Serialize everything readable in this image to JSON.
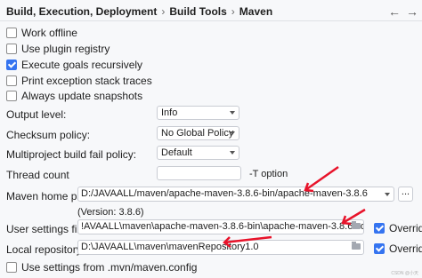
{
  "breadcrumb": {
    "items": [
      "Build, Execution, Deployment",
      "Build Tools",
      "Maven"
    ]
  },
  "nav": {
    "back": "←",
    "forward": "→"
  },
  "checkboxes": [
    {
      "label": "Work offline",
      "checked": false
    },
    {
      "label": "Use plugin registry",
      "checked": false
    },
    {
      "label": "Execute goals recursively",
      "checked": true
    },
    {
      "label": "Print exception stack traces",
      "checked": false
    },
    {
      "label": "Always update snapshots",
      "checked": false
    }
  ],
  "fields": {
    "output_level": {
      "label": "Output level:",
      "value": "Info"
    },
    "checksum_policy": {
      "label": "Checksum policy:",
      "value": "No Global Policy"
    },
    "multiproject_fail_policy": {
      "label": "Multiproject build fail policy:",
      "value": "Default"
    },
    "thread_count": {
      "label": "Thread count",
      "value": "",
      "suffix": "-T option"
    },
    "maven_home": {
      "label": "Maven home path:",
      "value": "D:/JAVAALL/maven/apache-maven-3.8.6-bin/apache-maven-3.8.6",
      "browse": "...",
      "version": "(Version: 3.8.6)"
    },
    "user_settings": {
      "label": "User settings file:",
      "value": "!AVAALL\\maven\\apache-maven-3.8.6-bin\\apache-maven-3.8.6\\conf\\settings.xml",
      "override_label": "Override",
      "override": true
    },
    "local_repo": {
      "label": "Local repository:",
      "value": "D:\\JAVAALL\\maven\\mavenRepository1.0",
      "override_label": "Override",
      "override": true
    }
  },
  "maven_config": {
    "label": "Use settings from .mvn/maven.config",
    "checked": false
  },
  "watermark": "CSDN @小天",
  "colors": {
    "accent": "#3574f0",
    "annotation": "#e8132a"
  }
}
